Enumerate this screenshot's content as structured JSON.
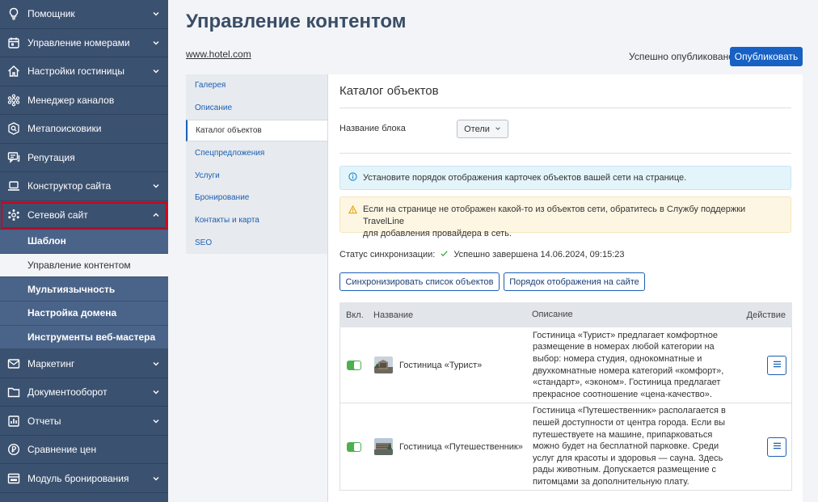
{
  "sidebar": {
    "items": [
      {
        "label": "Помощник",
        "icon": "lightbulb-icon",
        "has_chevron": true
      },
      {
        "label": "Управление номерами",
        "icon": "calendar-icon",
        "has_chevron": true
      },
      {
        "label": "Настройки гостиницы",
        "icon": "home-icon",
        "has_chevron": true
      },
      {
        "label": "Менеджер каналов",
        "icon": "channels-icon",
        "has_chevron": false
      },
      {
        "label": "Метапоисковики",
        "icon": "search-circle-icon",
        "has_chevron": false
      },
      {
        "label": "Репутация",
        "icon": "chat-icon",
        "has_chevron": false
      },
      {
        "label": "Конструктор сайта",
        "icon": "laptop-icon",
        "has_chevron": true
      },
      {
        "label": "Сетевой сайт",
        "icon": "network-icon",
        "has_chevron": true
      }
    ],
    "subitems": [
      "Шаблон",
      "Управление контентом",
      "Мультиязычность",
      "Настройка домена",
      "Инструменты веб-мастера"
    ],
    "items_after": [
      {
        "label": "Маркетинг",
        "icon": "mail-icon",
        "has_chevron": true
      },
      {
        "label": "Документооборот",
        "icon": "folder-icon",
        "has_chevron": true
      },
      {
        "label": "Отчеты",
        "icon": "reports-icon",
        "has_chevron": true
      },
      {
        "label": "Сравнение цен",
        "icon": "price-compare-icon",
        "has_chevron": false
      },
      {
        "label": "Модуль бронирования",
        "icon": "booking-icon",
        "has_chevron": true
      }
    ]
  },
  "header": {
    "title": "Управление контентом",
    "site_link": "www.hotel.com",
    "publish_status": "Успешно опубликовано",
    "publish_button": "Опубликовать"
  },
  "content_menu": [
    "Галерея",
    "Описание",
    "Каталог объектов",
    "Спецпредложения",
    "Услуги",
    "Бронирование",
    "Контакты и карта",
    "SEO"
  ],
  "panel": {
    "title": "Каталог объектов",
    "block_name_label": "Название блока",
    "block_name_value": "Отели",
    "info_alert": "Установите порядок отображения карточек объектов вашей сети на странице.",
    "warning_alert_line1": "Если на странице не отображен какой-то из объектов сети, обратитесь в Службу поддержки TravelLine",
    "warning_alert_line2": "для добавления провайдера в сеть.",
    "sync_label": "Статус синхронизации:",
    "sync_value": "Успешно завершена 14.06.2024, 09:15:23",
    "sync_button": "Синхронизировать список объектов",
    "order_button": "Порядок отображения на сайте"
  },
  "table": {
    "headers": {
      "enabled": "Вкл.",
      "name": "Название",
      "description": "Описание",
      "action": "Действие"
    },
    "rows": [
      {
        "name": "Гостиница «Турист»",
        "description": "Гостиница «Турист» предлагает комфортное размещение в номерах любой категории на выбор: номера студия, однокомнатные и двухкомнатные номера категорий «комфорт», «стандарт», «эконом». Гостиница предлагает прекрасное соотношение «цена-качество»."
      },
      {
        "name": "Гостиница «Путешественник»",
        "description": "Гостиница «Путешественник» располагается в пешей доступности от центра города. Если вы путешествуете на машине, припарковаться можно будет на бесплатной парковке. Среди услуг для красоты и здоровья — сауна. Здесь рады животным. Допускается размещение с питомцами за дополнительную плату."
      }
    ]
  },
  "colors": {
    "sidebar_bg": "#3b5170",
    "accent": "#1760c4",
    "highlight_outline": "#d0021b",
    "toggle_on": "#4caf50"
  }
}
